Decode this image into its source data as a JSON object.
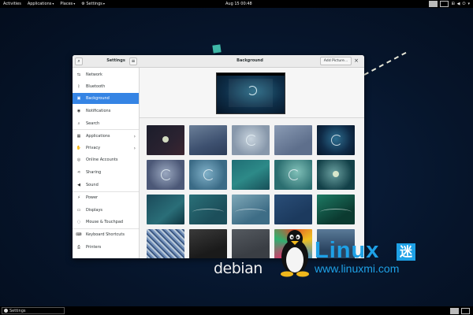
{
  "topbar": {
    "activities": "Activities",
    "applications": "Applications",
    "places": "Places",
    "settings": "Settings",
    "clock": "Aug 15  00:48"
  },
  "bottombar": {
    "task": "Settings"
  },
  "window": {
    "sidebar_title": "Settings",
    "page_title": "Background",
    "add_picture": "Add Picture...",
    "close": "×"
  },
  "sidebar": {
    "items": [
      {
        "label": "Network",
        "icon": "network-icon"
      },
      {
        "label": "Bluetooth",
        "icon": "bluetooth-icon"
      },
      {
        "label": "Background",
        "icon": "background-icon",
        "selected": true
      },
      {
        "label": "Notifications",
        "icon": "notifications-icon"
      },
      {
        "label": "Search",
        "icon": "search-icon"
      },
      {
        "label": "Applications",
        "icon": "applications-icon",
        "chevron": true
      },
      {
        "label": "Privacy",
        "icon": "privacy-icon",
        "chevron": true
      },
      {
        "label": "Online Accounts",
        "icon": "online-accounts-icon"
      },
      {
        "label": "Sharing",
        "icon": "sharing-icon"
      },
      {
        "label": "Sound",
        "icon": "sound-icon"
      },
      {
        "label": "Power",
        "icon": "power-icon"
      },
      {
        "label": "Displays",
        "icon": "displays-icon"
      },
      {
        "label": "Mouse & Touchpad",
        "icon": "mouse-icon"
      },
      {
        "label": "Keyboard Shortcuts",
        "icon": "keyboard-icon"
      },
      {
        "label": "Printers",
        "icon": "printer-icon"
      }
    ]
  },
  "watermark": {
    "debian": "debian",
    "linux": "Linux",
    "mi": "迷",
    "url": "www.linuxmi.com"
  },
  "colors": {
    "selected": "#3584e4",
    "brand": "#1ea1e6",
    "desktop": "#06152b"
  }
}
